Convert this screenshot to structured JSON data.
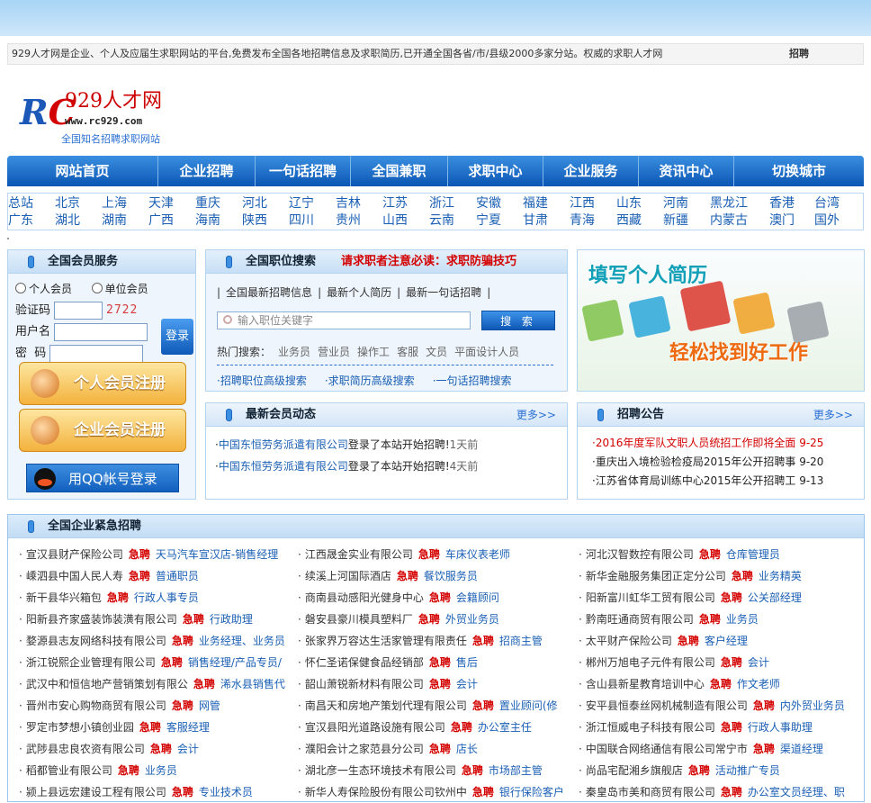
{
  "notice": {
    "text": "929人才网是企业、个人及应届生求职网站的平台,免费发布全国各地招聘信息及求职简历,已开通全国各省/市/县级2000多家分站。权威的求职人才网",
    "right": "招聘"
  },
  "logo": {
    "mark_a": "R",
    "mark_b": "C",
    "name": "929人才网",
    "url": "www.rc929.com",
    "slogan": "全国知名招聘求职网站"
  },
  "nav": [
    "网站首页",
    "企业招聘",
    "一句话招聘",
    "全国兼职",
    "求职中心",
    "企业服务",
    "资讯中心",
    "切换城市"
  ],
  "cities": {
    "row1": [
      "总站",
      "北京",
      "上海",
      "天津",
      "重庆",
      "河北",
      "辽宁",
      "吉林",
      "江苏",
      "浙江",
      "安徽",
      "福建",
      "江西",
      "山东",
      "河南",
      "黑龙江",
      "香港",
      "台湾"
    ],
    "row2": [
      "广东",
      "湖北",
      "湖南",
      "广西",
      "海南",
      "陕西",
      "四川",
      "贵州",
      "山西",
      "云南",
      "宁夏",
      "甘肃",
      "青海",
      "西藏",
      "新疆",
      "内蒙古",
      "澳门",
      "国外"
    ]
  },
  "login": {
    "title": "全国会员服务",
    "radio_personal": "个人会员",
    "radio_company": "单位会员",
    "captcha_label": "验证码",
    "captcha_code": "2722",
    "user_label": "用户名",
    "pwd_label": "密  码",
    "login_btn": "登录",
    "reg_personal": "个人会员注册",
    "reg_company": "企业会员注册",
    "qq_login": "用QQ帐号登录"
  },
  "search": {
    "title": "全国职位搜索",
    "warning": "请求职者注意必读：求职防骗技巧",
    "links": [
      "全国最新招聘信息",
      "最新个人简历",
      "最新一句话招聘"
    ],
    "placeholder": "输入职位关键字",
    "button": "搜 索",
    "hot_label": "热门搜索：",
    "hot": [
      "业务员",
      "营业员",
      "操作工",
      "客服",
      "文员",
      "平面设计人员"
    ],
    "adv": [
      "招聘职位高级搜索",
      "求职简历高级搜索",
      "一句话招聘搜索"
    ]
  },
  "banner": {
    "line1": "填写个人简历",
    "line2": "轻松找到好工作"
  },
  "news": {
    "title": "最新会员动态",
    "more": "更多>>",
    "items": [
      {
        "company": "中国东恒劳务派遣有限公司",
        "action": "登录了本站开始招聘!",
        "time": "1天前"
      },
      {
        "company": "中国东恒劳务派遣有限公司",
        "action": "登录了本站开始招聘!",
        "time": "4天前"
      }
    ]
  },
  "ann": {
    "title": "招聘公告",
    "more": "更多>>",
    "items": [
      {
        "text": "2016年度军队文职人员统招工作即将全面",
        "date": "9-25"
      },
      {
        "text": "重庆出入境检验检疫局2015年公开招聘事",
        "date": "9-20"
      },
      {
        "text": "江苏省体育局训练中心2015年公开招聘工",
        "date": "9-13"
      }
    ]
  },
  "urgent": {
    "title": "全国企业紧急招聘",
    "tag": "急聘",
    "col1": [
      {
        "c": "宣汉县财产保险公司",
        "j": "天马汽车宣汉店-销售经理"
      },
      {
        "c": "嵊泗县中国人民人寿",
        "j": "普通职员"
      },
      {
        "c": "新干县华兴箱包",
        "j": "行政人事专员"
      },
      {
        "c": "阳新县齐家盛装饰装潢有限公司",
        "j": "行政助理"
      },
      {
        "c": "婺源县志友网络科技有限公司",
        "j": "业务经理、业务员"
      },
      {
        "c": "浙江锐熙企业管理有限公司",
        "j": "销售经理/产品专员/"
      },
      {
        "c": "武汉中和恒信地产营销策划有限公",
        "j": "浠水县销售代"
      },
      {
        "c": "晋州市安心购物商贸有限公司",
        "j": "网管"
      },
      {
        "c": "罗定市梦想小镇创业园",
        "j": "客服经理"
      },
      {
        "c": "武陟县忠良农资有限公司",
        "j": "会计"
      },
      {
        "c": "稻都管业有限公司",
        "j": "业务员"
      },
      {
        "c": "颍上县远宏建设工程有限公司",
        "j": "专业技术员"
      }
    ],
    "col2": [
      {
        "c": "江西晟金实业有限公司",
        "j": "车床仪表老师"
      },
      {
        "c": "续溪上河国际酒店",
        "j": "餐饮服务员"
      },
      {
        "c": "商南县动感阳光健身中心",
        "j": "会籍顾问"
      },
      {
        "c": "磐安县豪川模具塑料厂",
        "j": "外贸业务员"
      },
      {
        "c": "张家界万容达生活家管理有限责任",
        "j": "招商主管"
      },
      {
        "c": "怀仁圣诺保健食品经销部",
        "j": "售后"
      },
      {
        "c": "韶山萧锐新材料有限公司",
        "j": "会计"
      },
      {
        "c": "南昌天和房地产策划代理有限公司",
        "j": "置业顾问(修"
      },
      {
        "c": "宣汉县阳光道路设施有限公司",
        "j": "办公室主任"
      },
      {
        "c": "濮阳会计之家范县分公司",
        "j": "店长"
      },
      {
        "c": "湖北彦一生态环境技术有限公司",
        "j": "市场部主管"
      },
      {
        "c": "新华人寿保险股份有限公司钦州中",
        "j": "银行保险客户"
      }
    ],
    "col3": [
      {
        "c": "河北汉智数控有限公司",
        "j": "仓库管理员"
      },
      {
        "c": "新华金融服务集团正定分公司",
        "j": "业务精英"
      },
      {
        "c": "阳新富川虹华工贸有限公司",
        "j": "公关部经理"
      },
      {
        "c": "黔南旺通商贸有限公司",
        "j": "业务员"
      },
      {
        "c": "太平财产保险公司",
        "j": "客户经理"
      },
      {
        "c": "郴州万旭电子元件有限公司",
        "j": "会计"
      },
      {
        "c": "含山县新星教育培训中心",
        "j": "作文老师"
      },
      {
        "c": "安平县恒泰丝网机械制造有限公司",
        "j": "内外贸业务员"
      },
      {
        "c": "浙江恒威电子科技有限公司",
        "j": "行政人事助理"
      },
      {
        "c": "中国联合网络通信有限公司常宁市",
        "j": "渠道经理"
      },
      {
        "c": "尚品宅配湘乡旗舰店",
        "j": "活动推广专员"
      },
      {
        "c": "秦皇岛市美和商贸有限公司",
        "j": "办公室文员经理、职"
      }
    ]
  }
}
